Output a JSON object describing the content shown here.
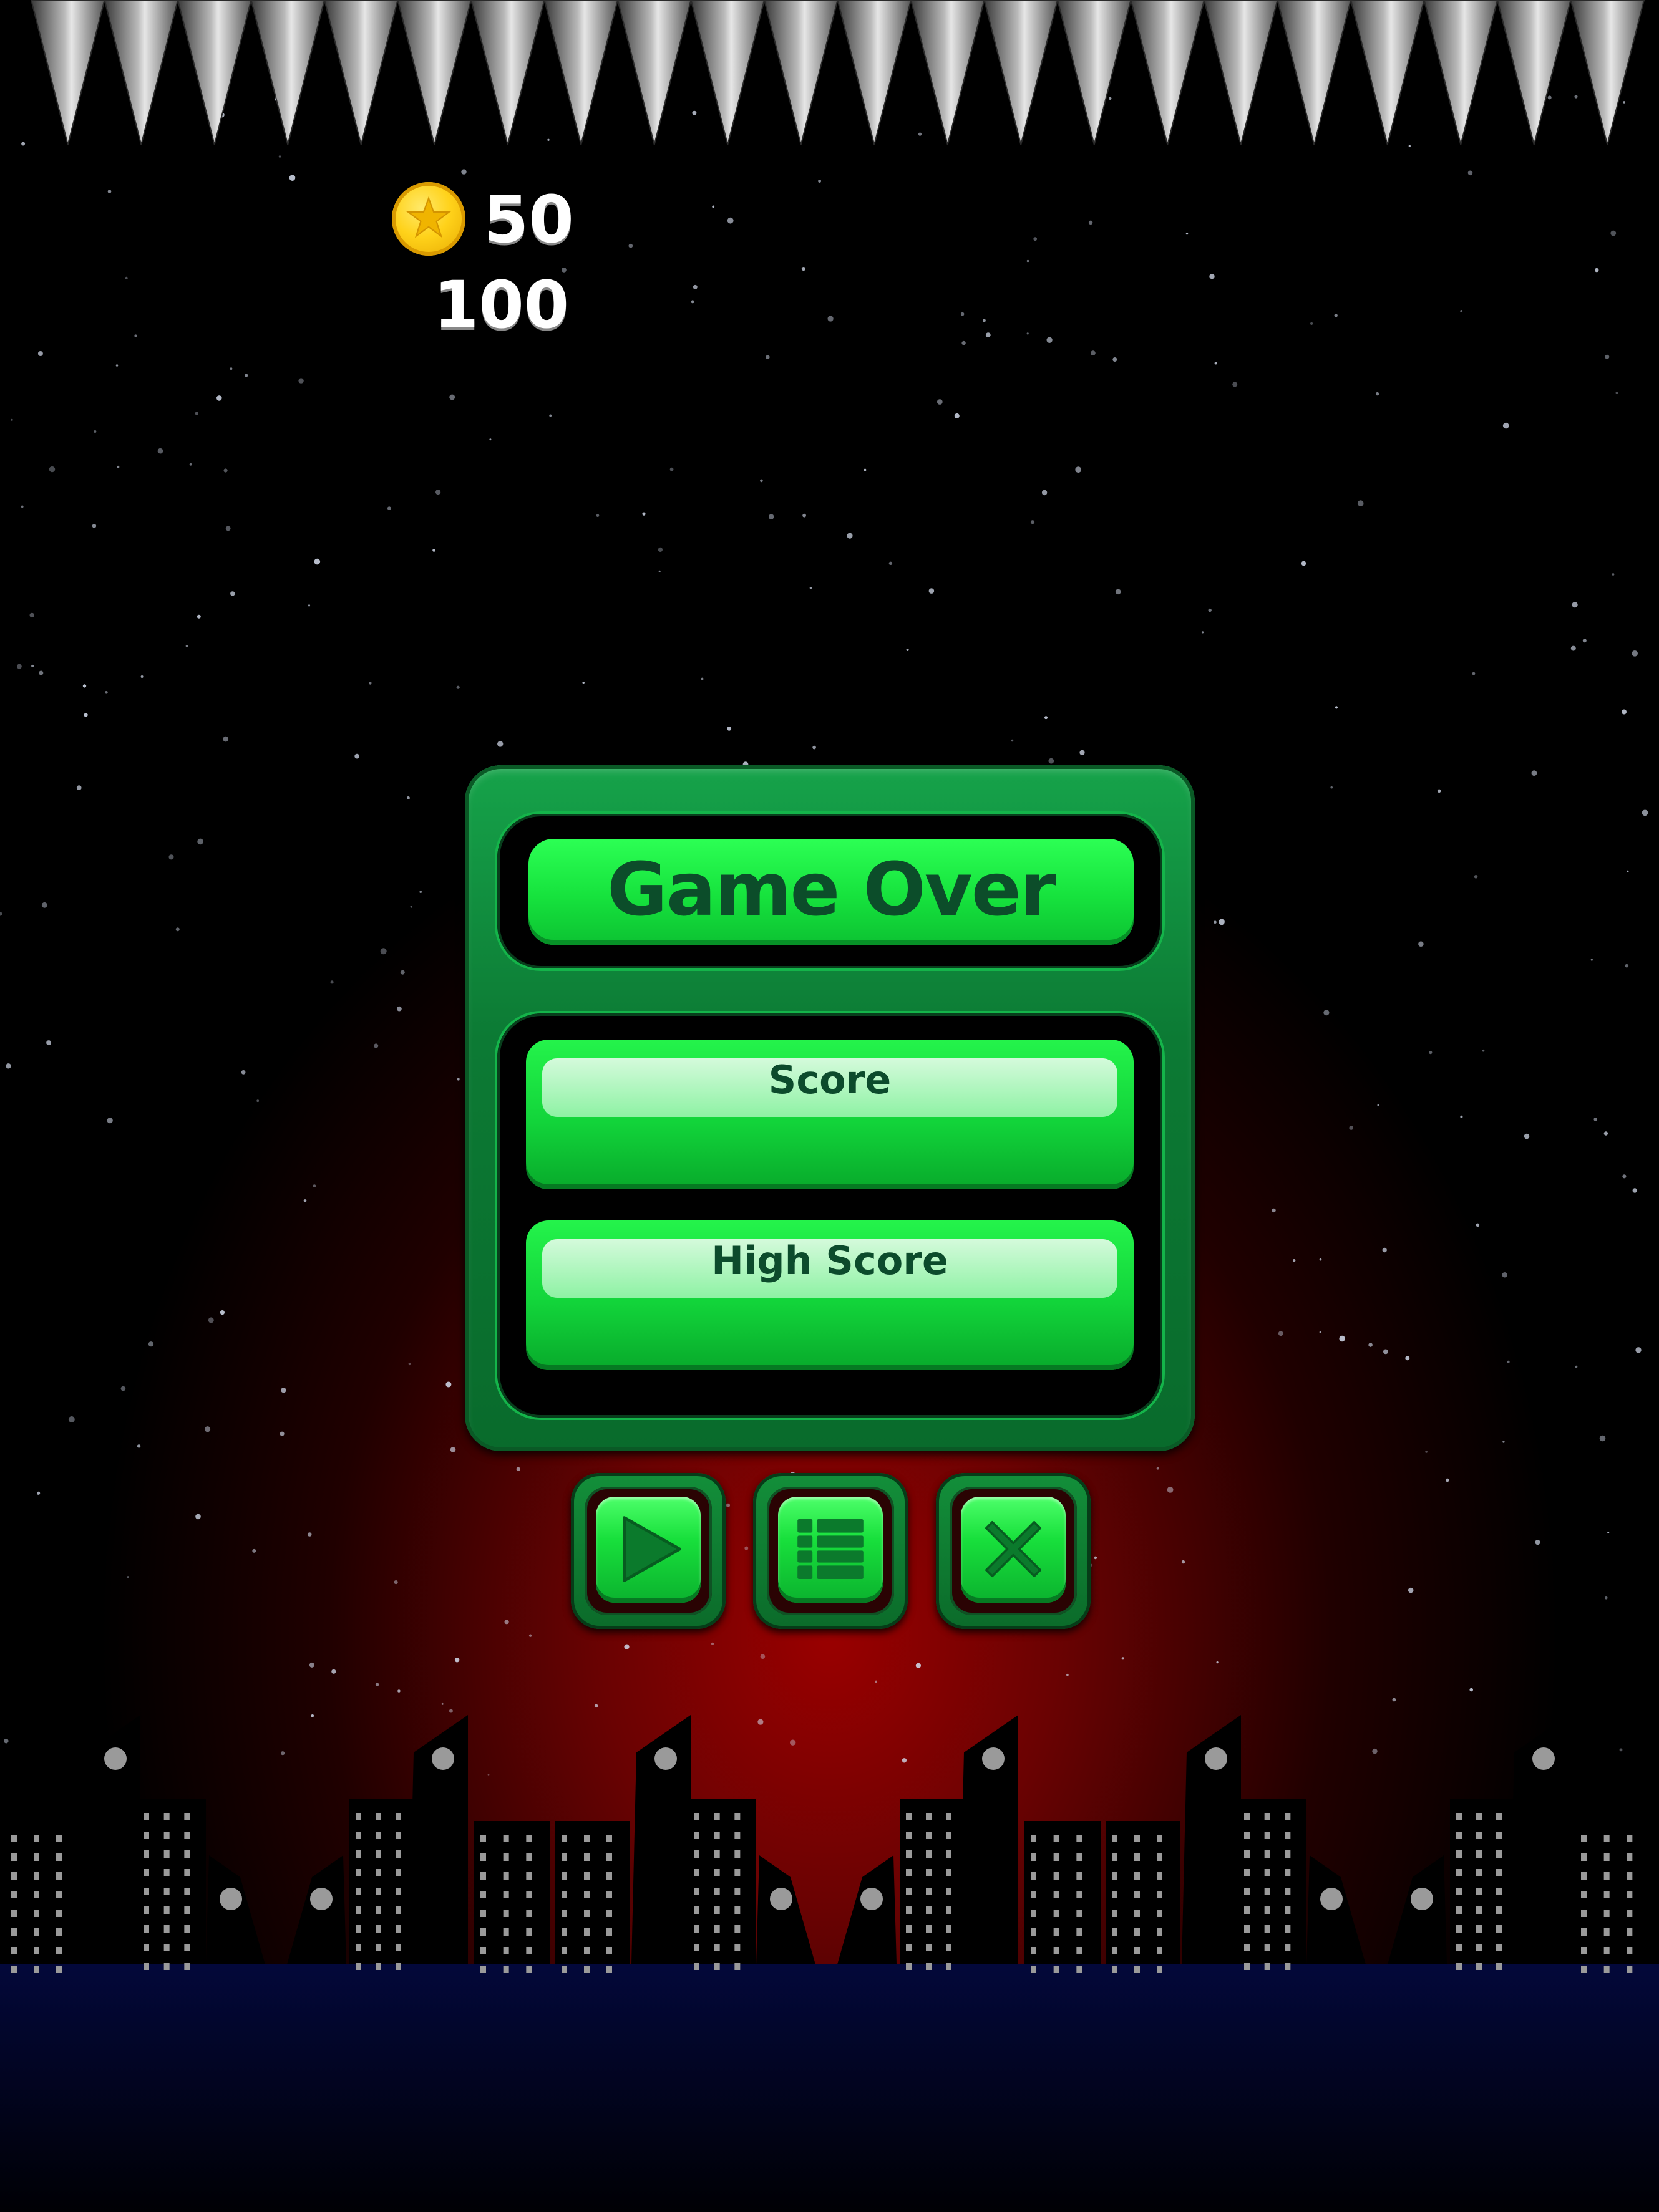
{
  "hud": {
    "coins": "50",
    "score": "100",
    "coin_icon": "star-coin-icon"
  },
  "dialog": {
    "title": "Game Over",
    "score_label": "Score",
    "high_score_label": "High Score"
  },
  "buttons": [
    {
      "name": "play",
      "icon": "play-icon"
    },
    {
      "name": "menu",
      "icon": "list-icon"
    },
    {
      "name": "close",
      "icon": "close-icon"
    }
  ],
  "colors": {
    "panel": "#0c7a34",
    "bright_green": "#16e23d",
    "label_text": "#0c4b2c",
    "coin": "#ffd21a",
    "horizon_glow": "#8a0000",
    "ground": "#020633"
  }
}
